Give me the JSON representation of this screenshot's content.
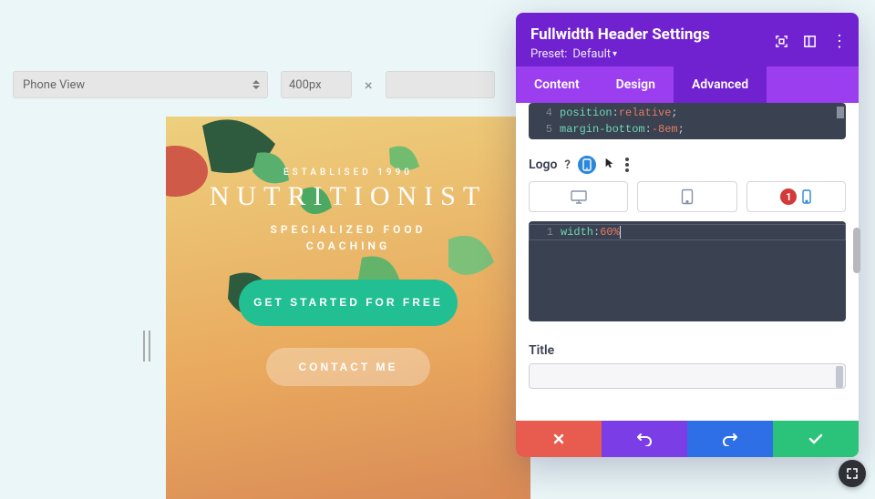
{
  "top": {
    "view_label": "Phone View",
    "width_value": "400px",
    "dim_separator": "×"
  },
  "hero": {
    "eyebrow": "ESTABLISED 1990",
    "title": "NUTRITIONIST",
    "subhead_line1": "SPECIALIZED FOOD",
    "subhead_line2": "COACHING",
    "cta_primary": "GET STARTED FOR FREE",
    "cta_secondary": "CONTACT ME"
  },
  "panel": {
    "title": "Fullwidth Header Settings",
    "preset_label": "Preset:",
    "preset_value": "Default",
    "tabs": {
      "content": "Content",
      "design": "Design",
      "advanced": "Advanced"
    },
    "code_top": {
      "line_numbers": [
        "4",
        "5"
      ],
      "line4_prop": "position",
      "line4_val": "relative",
      "line5_prop": "margin-bottom",
      "line5_val": "-8em"
    },
    "logo_section": {
      "label": "Logo",
      "badge": "1"
    },
    "code_logo": {
      "line_num": "1",
      "prop": "width",
      "val": "60%"
    },
    "title_section": {
      "label": "Title"
    }
  }
}
